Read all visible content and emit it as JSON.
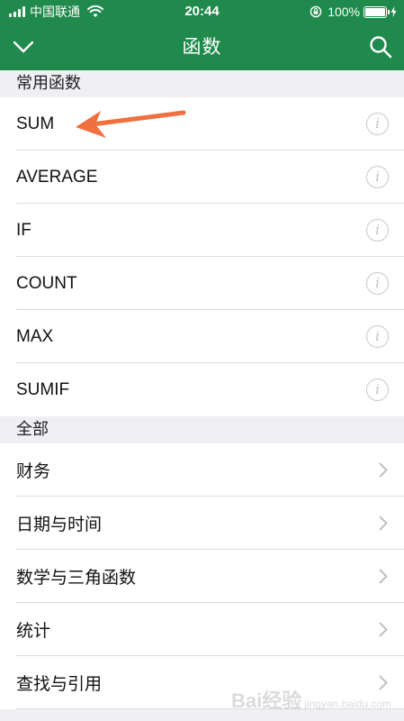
{
  "status_bar": {
    "carrier": "中国联通",
    "time": "20:44",
    "battery": "100%",
    "battery_level": 1.0
  },
  "header": {
    "title": "函数",
    "back_icon": "chevron-down-icon",
    "search_icon": "search-icon",
    "background_color": "#1f8a4c"
  },
  "sections": {
    "common": {
      "title": "常用函数",
      "items": [
        {
          "label": "SUM",
          "icon": "info-icon"
        },
        {
          "label": "AVERAGE",
          "icon": "info-icon"
        },
        {
          "label": "IF",
          "icon": "info-icon"
        },
        {
          "label": "COUNT",
          "icon": "info-icon"
        },
        {
          "label": "MAX",
          "icon": "info-icon"
        },
        {
          "label": "SUMIF",
          "icon": "info-icon"
        }
      ]
    },
    "all": {
      "title": "全部",
      "items": [
        {
          "label": "财务",
          "icon": "chevron-right-icon"
        },
        {
          "label": "日期与时间",
          "icon": "chevron-right-icon"
        },
        {
          "label": "数学与三角函数",
          "icon": "chevron-right-icon"
        },
        {
          "label": "统计",
          "icon": "chevron-right-icon"
        },
        {
          "label": "查找与引用",
          "icon": "chevron-right-icon"
        }
      ]
    }
  },
  "annotation": {
    "arrow_color": "#f07040",
    "points_to": "SUM"
  },
  "watermark": {
    "logo_text": "Bai经验",
    "sub_text": "jingyan.baidu.com"
  }
}
